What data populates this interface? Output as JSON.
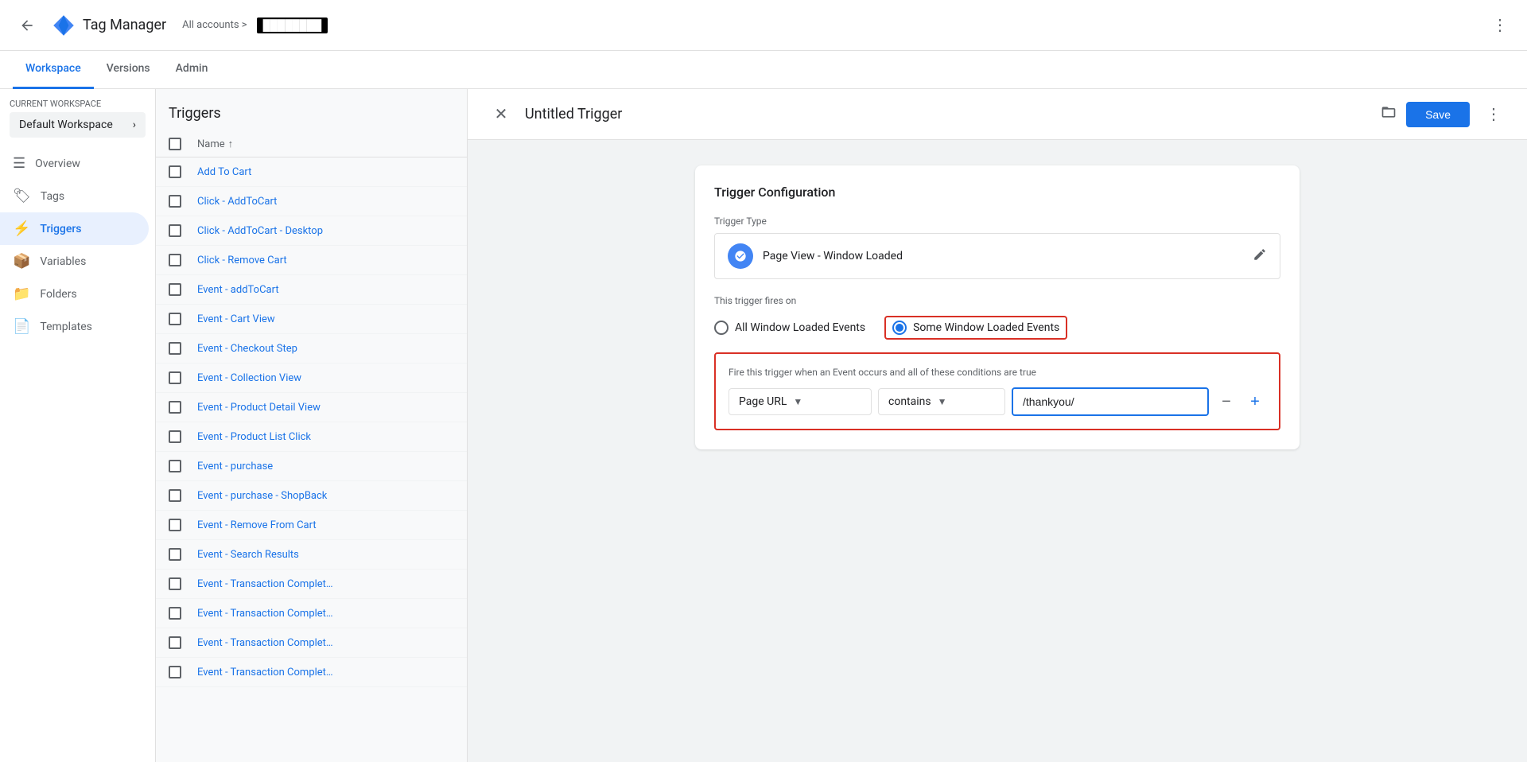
{
  "topbar": {
    "back_title": "back",
    "app_name": "Tag Manager",
    "account_prefix": "All accounts >",
    "account_name": "████████",
    "more_icon": "⋮"
  },
  "nav": {
    "tabs": [
      {
        "label": "Workspace",
        "active": true
      },
      {
        "label": "Versions",
        "active": false
      },
      {
        "label": "Admin",
        "active": false
      }
    ]
  },
  "sidebar": {
    "workspace_label": "CURRENT WORKSPACE",
    "workspace_name": "Default Workspace",
    "workspace_arrow": "›",
    "nav_items": [
      {
        "label": "Overview",
        "icon": "☰",
        "active": false
      },
      {
        "label": "Tags",
        "icon": "🏷",
        "active": false
      },
      {
        "label": "Triggers",
        "icon": "⚡",
        "active": true
      },
      {
        "label": "Variables",
        "icon": "📦",
        "active": false
      },
      {
        "label": "Folders",
        "icon": "📁",
        "active": false
      },
      {
        "label": "Templates",
        "icon": "📄",
        "active": false
      }
    ]
  },
  "triggers_panel": {
    "title": "Triggers",
    "col_name": "Name",
    "sort_icon": "↑",
    "items": [
      {
        "name": "Add To Cart"
      },
      {
        "name": "Click - AddToCart"
      },
      {
        "name": "Click - AddToCart - Desktop"
      },
      {
        "name": "Click - Remove Cart"
      },
      {
        "name": "Event - addToCart"
      },
      {
        "name": "Event - Cart View"
      },
      {
        "name": "Event - Checkout Step"
      },
      {
        "name": "Event - Collection View"
      },
      {
        "name": "Event - Product Detail View"
      },
      {
        "name": "Event - Product List Click"
      },
      {
        "name": "Event - purchase"
      },
      {
        "name": "Event - purchase - ShopBack"
      },
      {
        "name": "Event - Remove From Cart"
      },
      {
        "name": "Event - Search Results"
      },
      {
        "name": "Event - Transaction Complet…"
      },
      {
        "name": "Event - Transaction Complet…"
      },
      {
        "name": "Event - Transaction Complet…"
      },
      {
        "name": "Event - Transaction Complet…"
      }
    ]
  },
  "panel_header": {
    "close_icon": "✕",
    "title": "Untitled Trigger",
    "folder_icon": "⬜",
    "save_label": "Save",
    "more_icon": "⋮"
  },
  "trigger_config": {
    "card_title": "Trigger Configuration",
    "trigger_type_label": "Trigger Type",
    "trigger_type_name": "Page View - Window Loaded",
    "edit_icon": "✏",
    "fires_on_label": "This trigger fires on",
    "radio_all_label": "All Window Loaded Events",
    "radio_some_label": "Some Window Loaded Events",
    "condition_label": "Fire this trigger when an Event occurs and all of these conditions are true",
    "condition_field": "Page URL",
    "condition_operator": "contains",
    "condition_value": "/thankyou/",
    "minus_icon": "−",
    "plus_icon": "+"
  }
}
